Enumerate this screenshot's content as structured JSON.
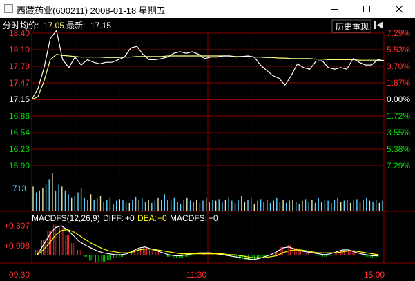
{
  "window": {
    "title": "西藏药业(600211) 2008-01-18 星期五"
  },
  "toolbar": {
    "history_label": "历史重现",
    "back_icon": "arrow-left-bar-icon"
  },
  "header": {
    "mode": "分时",
    "avg_label": "均价:",
    "avg_value": "17.05",
    "latest_label": "最新:",
    "latest_value": "17.15"
  },
  "colors": {
    "background": "#000000",
    "grid": "#8b0000",
    "price_up": "#ff3030",
    "price_down": "#00e000",
    "flat": "#ffffff",
    "volume": "#5fd3ff",
    "avg_line": "#ffff80",
    "dea": "#ffff00"
  },
  "price_axis": {
    "left": [
      "18.40",
      "18.10",
      "17.78",
      "17.47",
      "17.15",
      "16.86",
      "16.54",
      "16.23",
      "15.90"
    ],
    "right": [
      "7.29%",
      "5.53%",
      "3.70%",
      "1.87%",
      "0.00%",
      "1.72%",
      "3.55%",
      "5.38%",
      "7.29%"
    ],
    "right_kind": [
      "up",
      "up",
      "up",
      "up",
      "flat",
      "down",
      "down",
      "down",
      "down"
    ],
    "left_kind": [
      "up",
      "up",
      "up",
      "up",
      "flat",
      "down",
      "down",
      "down",
      "down"
    ],
    "max": 18.4,
    "min": 15.9,
    "prev_close": 17.15
  },
  "volume_axis": {
    "label": "713"
  },
  "macd": {
    "title": "MACDFS(12,26,9)",
    "diff_label": "DIFF:",
    "diff_value": "+0",
    "dea_label": "DEA:",
    "dea_value": "+0",
    "macdfs_label": "MACDFS:",
    "macdfs_value": "+0",
    "axis": [
      "+0.307",
      "+0.098"
    ]
  },
  "time_axis": [
    "09:30",
    "11:30",
    "15:00"
  ],
  "chart_data": {
    "type": "line",
    "price_series": [
      17.15,
      17.35,
      17.75,
      18.3,
      18.45,
      17.9,
      17.75,
      17.95,
      17.8,
      17.9,
      17.85,
      17.82,
      17.85,
      17.85,
      17.9,
      17.95,
      18.12,
      18.15,
      18.0,
      17.9,
      17.9,
      17.92,
      17.95,
      18.02,
      18.05,
      18.02,
      18.05,
      18.0,
      17.92,
      17.95,
      17.95,
      17.97,
      17.97,
      17.95,
      17.96,
      17.97,
      17.95,
      17.8,
      17.7,
      17.6,
      17.55,
      17.42,
      17.6,
      17.82,
      17.75,
      17.72,
      17.87,
      17.88,
      17.75,
      17.72,
      17.75,
      17.72,
      17.92,
      17.85,
      17.8,
      17.8,
      17.9,
      17.88
    ],
    "avg_series": [
      17.15,
      17.2,
      17.5,
      17.9,
      18.0,
      17.98,
      17.97,
      17.96,
      17.95,
      17.95,
      17.95,
      17.95,
      17.94,
      17.94,
      17.94,
      17.95,
      17.95,
      17.96,
      17.96,
      17.96,
      17.96,
      17.96,
      17.97,
      17.97,
      17.97,
      17.97,
      17.97,
      17.97,
      17.97,
      17.97,
      17.97,
      17.97,
      17.97,
      17.96,
      17.96,
      17.96,
      17.95,
      17.95,
      17.94,
      17.94,
      17.93,
      17.93,
      17.92,
      17.92,
      17.92,
      17.92,
      17.91,
      17.91,
      17.9,
      17.9,
      17.9,
      17.9,
      17.9,
      17.89,
      17.89,
      17.89,
      17.89,
      17.88
    ],
    "volume_series": [
      0.65,
      0.5,
      0.55,
      0.6,
      0.7,
      0.85,
      1.0,
      0.55,
      0.7,
      0.65,
      0.55,
      0.45,
      0.35,
      0.4,
      0.5,
      0.6,
      0.35,
      0.3,
      0.45,
      0.3,
      0.35,
      0.4,
      0.25,
      0.3,
      0.35,
      0.2,
      0.28,
      0.32,
      0.3,
      0.25,
      0.22,
      0.3,
      0.38,
      0.3,
      0.35,
      0.25,
      0.3,
      0.22,
      0.28,
      0.35,
      0.3,
      0.45,
      0.3,
      0.28,
      0.35,
      0.25,
      0.2,
      0.3,
      0.35,
      0.28,
      0.25,
      0.3,
      0.22,
      0.28,
      0.35,
      0.25,
      0.3,
      0.28,
      0.32,
      0.25,
      0.3,
      0.35,
      0.28,
      0.22,
      0.3,
      0.4,
      0.25,
      0.3,
      0.35,
      0.2,
      0.28,
      0.32,
      0.25,
      0.3,
      0.22,
      0.28,
      0.35,
      0.25,
      0.3,
      0.22,
      0.28,
      0.3,
      0.25,
      0.2,
      0.28,
      0.32,
      0.25,
      0.3,
      0.22,
      0.35,
      0.25,
      0.3,
      0.28,
      0.22,
      0.3,
      0.35,
      0.25,
      0.28,
      0.3,
      0.22,
      0.28,
      0.32,
      0.25,
      0.3,
      0.35,
      0.28,
      0.25,
      0.3,
      0.22,
      0.28
    ],
    "macd_hist": [
      0.05,
      0.15,
      0.25,
      0.31,
      0.28,
      0.2,
      0.12,
      0.05,
      -0.02,
      -0.06,
      -0.08,
      -0.07,
      -0.05,
      -0.03,
      -0.02,
      0.0,
      0.03,
      0.06,
      0.07,
      0.05,
      0.03,
      0.0,
      -0.02,
      -0.03,
      -0.03,
      -0.02,
      -0.01,
      0.0,
      0.01,
      0.02,
      0.01,
      0.0,
      -0.01,
      -0.02,
      -0.04,
      -0.05,
      -0.05,
      -0.04,
      -0.02,
      0.0,
      0.02,
      0.08,
      0.1,
      0.07,
      0.04,
      0.02,
      0.0,
      -0.01,
      -0.02,
      -0.01,
      0.01,
      0.04,
      0.05,
      0.03,
      0.0,
      -0.02,
      -0.03,
      -0.02
    ],
    "diff_series": [
      0.0,
      0.1,
      0.2,
      0.28,
      0.3,
      0.26,
      0.2,
      0.14,
      0.1,
      0.07,
      0.04,
      0.02,
      0.01,
      0.0,
      0.0,
      0.01,
      0.04,
      0.07,
      0.08,
      0.06,
      0.04,
      0.02,
      0.0,
      -0.01,
      -0.01,
      0.0,
      0.01,
      0.02,
      0.02,
      0.02,
      0.01,
      0.0,
      -0.01,
      -0.02,
      -0.03,
      -0.04,
      -0.05,
      -0.04,
      -0.02,
      0.0,
      0.03,
      0.07,
      0.08,
      0.06,
      0.04,
      0.03,
      0.02,
      0.01,
      0.0,
      0.01,
      0.03,
      0.05,
      0.05,
      0.03,
      0.01,
      0.0,
      -0.01,
      -0.01
    ],
    "dea_series": [
      0.0,
      0.05,
      0.12,
      0.2,
      0.25,
      0.26,
      0.24,
      0.2,
      0.16,
      0.12,
      0.09,
      0.06,
      0.04,
      0.03,
      0.02,
      0.02,
      0.03,
      0.05,
      0.06,
      0.06,
      0.05,
      0.04,
      0.03,
      0.02,
      0.01,
      0.01,
      0.01,
      0.01,
      0.01,
      0.01,
      0.01,
      0.01,
      0.0,
      0.0,
      -0.01,
      -0.02,
      -0.03,
      -0.03,
      -0.03,
      -0.02,
      -0.01,
      0.02,
      0.04,
      0.05,
      0.05,
      0.04,
      0.03,
      0.02,
      0.02,
      0.02,
      0.02,
      0.03,
      0.04,
      0.04,
      0.03,
      0.02,
      0.01,
      0.0
    ]
  }
}
